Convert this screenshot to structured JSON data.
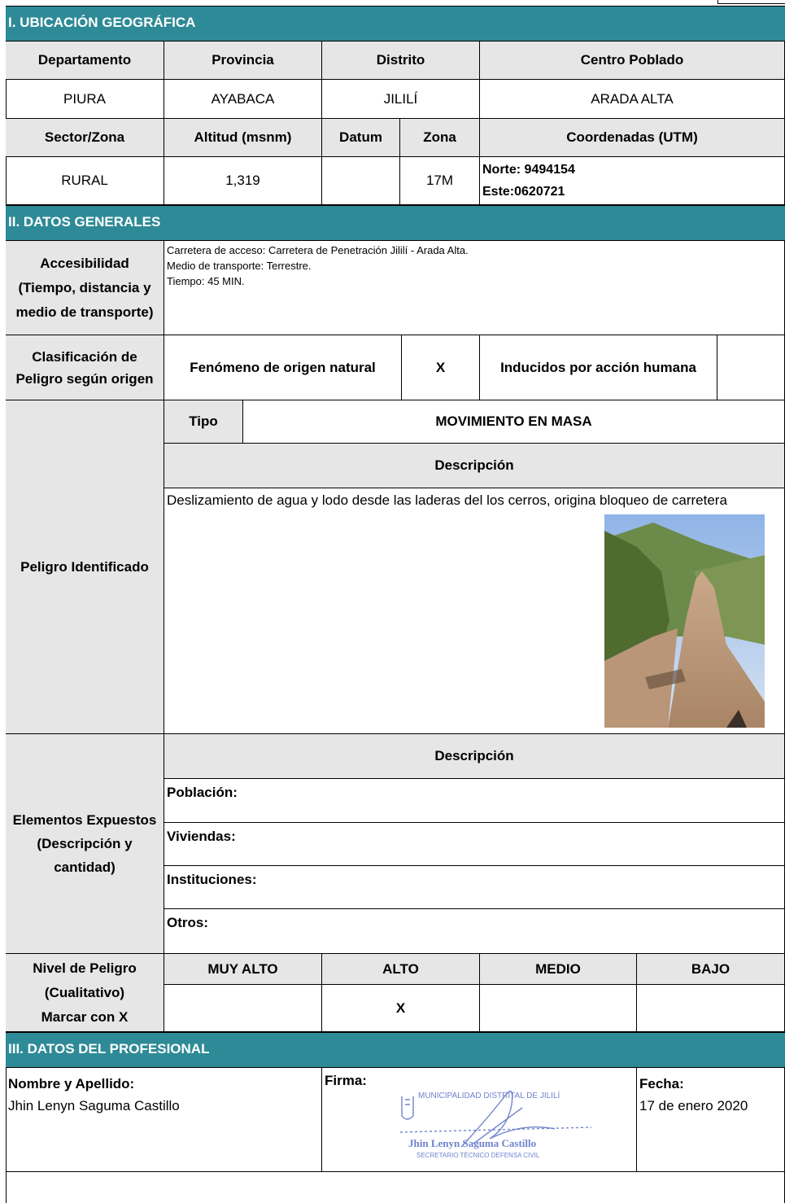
{
  "sections": {
    "s1": "I. UBICACIÓN GEOGRÁFICA",
    "s2": "II. DATOS GENERALES",
    "s3": "III. DATOS DEL PROFESIONAL"
  },
  "ubicacion": {
    "h_departamento": "Departamento",
    "h_provincia": "Provincia",
    "h_distrito": "Distrito",
    "h_centro_poblado": "Centro Poblado",
    "departamento": "PIURA",
    "provincia": "AYABACA",
    "distrito": "JILILÍ",
    "centro_poblado": "ARADA ALTA",
    "h_sector": "Sector/Zona",
    "h_altitud": "Altitud (msnm)",
    "h_datum": "Datum",
    "h_zona": "Zona",
    "h_coordenadas": "Coordenadas (UTM)",
    "sector": "RURAL",
    "altitud": "1,319",
    "datum": "",
    "zona": "17M",
    "norte": "Norte: 9494154",
    "este": "Este:0620721"
  },
  "generales": {
    "accesibilidad_label": [
      "Accesibilidad",
      "(Tiempo, distancia y",
      "medio de transporte)"
    ],
    "accesibilidad_lines": [
      "Carretera de acceso: Carretera de Penetración Jililí - Arada Alta.",
      "Medio de transporte: Terrestre.",
      "Tiempo: 45 MIN."
    ],
    "clasificacion_label": [
      "Clasificación de",
      "Peligro según origen"
    ],
    "fenomeno_natural": "Fenómeno de origen natural",
    "natural_mark": "X",
    "inducidos": "Inducidos por acción humana",
    "inducidos_mark": "",
    "peligro_label": "Peligro Identificado",
    "tipo_label": "Tipo",
    "tipo_value": "MOVIMIENTO EN MASA",
    "descripcion_label": "Descripción",
    "descripcion_text": "Deslizamiento de agua y lodo desde las laderas del los cerros, origina bloqueo de carretera",
    "elementos_label": [
      "Elementos Expuestos",
      "(Descripción y",
      "cantidad)"
    ],
    "elementos_descripcion": "Descripción",
    "poblacion": "Población:",
    "viviendas": "Viviendas:",
    "instituciones": "Instituciones:",
    "otros": "Otros:",
    "nivel_label": [
      "Nivel de Peligro",
      "(Cualitativo)",
      "Marcar con X"
    ],
    "niveles": [
      "MUY ALTO",
      "ALTO",
      "MEDIO",
      "BAJO"
    ],
    "nivel_marks": [
      "",
      "X",
      "",
      ""
    ]
  },
  "profesional": {
    "nombre_label": "Nombre y Apellido:",
    "nombre": "Jhin Lenyn Saguma Castillo",
    "firma_label": "Firma:",
    "fecha_label": "Fecha:",
    "fecha": "17 de enero 2020",
    "stamp_lines": [
      "MUNICIPALIDAD DISTRITAL DE JILILÍ",
      "Jhin Lenyn Saguma Castillo",
      "SECRETARIO TÉCNICO DEFENSA CIVIL"
    ]
  },
  "colors": {
    "section_header": "#2e8a96",
    "label_cell": "#e6e6e6"
  }
}
